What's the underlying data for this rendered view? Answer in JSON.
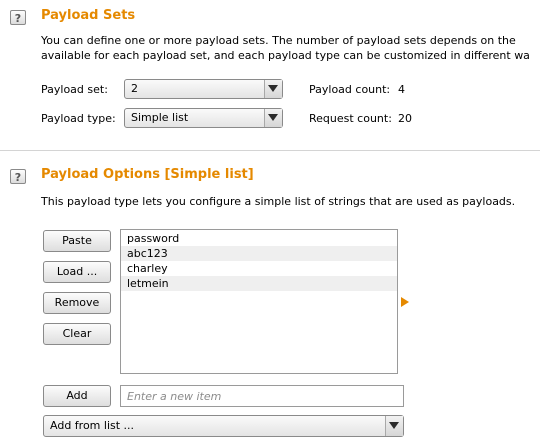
{
  "payload_sets": {
    "help": "?",
    "title": "Payload Sets",
    "description_line1": "You can define one or more payload sets. The number of payload sets depends on the",
    "description_line2": "available for each payload set, and each payload type can be customized in different wa",
    "payload_set_label": "Payload set:",
    "payload_set_value": "2",
    "payload_type_label": "Payload type:",
    "payload_type_value": "Simple list",
    "payload_count_label": "Payload count:",
    "payload_count_value": "4",
    "request_count_label": "Request count:",
    "request_count_value": "20"
  },
  "payload_options": {
    "help": "?",
    "title": "Payload Options [Simple list]",
    "description": "This payload type lets you configure a simple list of strings that are used as payloads.",
    "buttons": {
      "paste": "Paste",
      "load": "Load ...",
      "remove": "Remove",
      "clear": "Clear",
      "add": "Add"
    },
    "items": [
      "password",
      "abc123",
      "charley",
      "letmein"
    ],
    "new_item_placeholder": "Enter a new item",
    "add_from_list": "Add from list ..."
  },
  "colors": {
    "section_title": "#e58900",
    "expand_arrow": "#e58900",
    "list_alt_row": "#efefef"
  },
  "icons": {
    "help": "help-icon",
    "dropdown": "chevron-down-icon",
    "expand": "triangle-right-icon"
  }
}
